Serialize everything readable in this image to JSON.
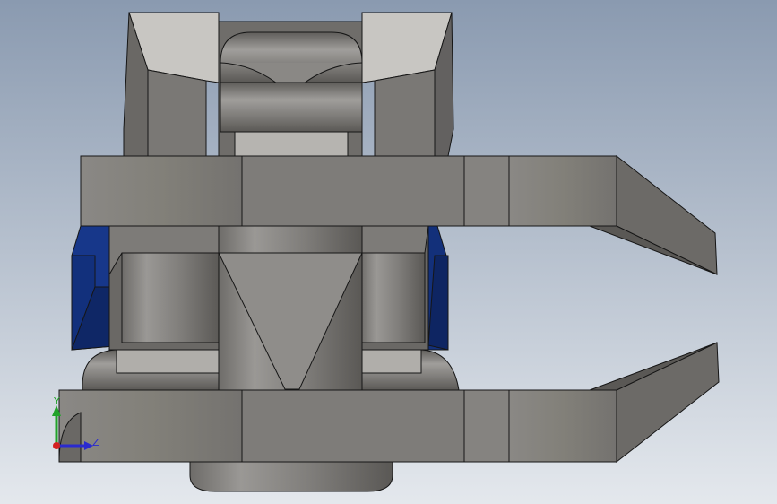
{
  "viewport": {
    "background": {
      "top": "#8a9ab0",
      "bottom": "#e4e8ed"
    },
    "model": {
      "body_color": "#7d7b78",
      "light_face_color": "#c8c6c2",
      "dark_face_color": "#55534f",
      "highlight_color": "#123584",
      "edge_color": "#161616"
    },
    "triad": {
      "y_label": "Y",
      "z_label": "Z",
      "y_color": "#22a22a",
      "z_color": "#2a2ad0",
      "x_color": "#d42020"
    }
  }
}
